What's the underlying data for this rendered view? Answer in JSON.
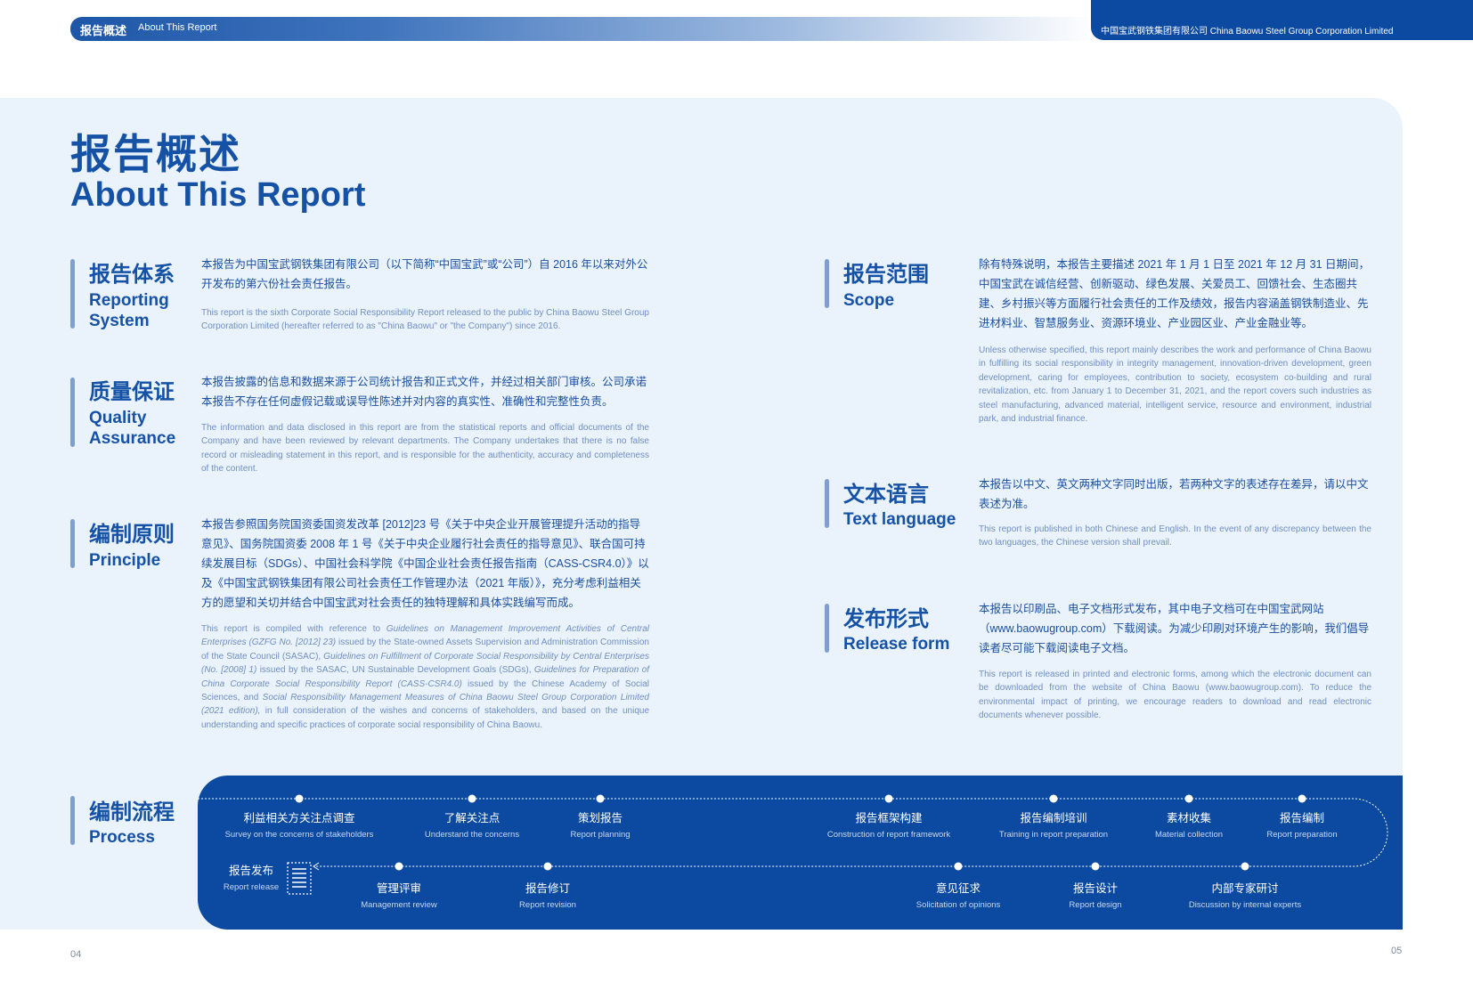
{
  "header": {
    "section_zh": "报告概述",
    "section_en": "About This Report",
    "company": "中国宝武钢铁集团有限公司 China Baowu Steel Group Corporation Limited"
  },
  "title": {
    "zh": "报告概述",
    "en": "About This Report"
  },
  "sections": {
    "reporting_system": {
      "title_zh": "报告体系",
      "title_en": "Reporting System",
      "body_zh": "本报告为中国宝武钢铁集团有限公司（以下简称“中国宝武”或“公司”）自 2016 年以来对外公开发布的第六份社会责任报告。",
      "body_en": "This report is the sixth Corporate Social Responsibility Report released to the public by China Baowu Steel Group Corporation Limited (hereafter referred to as \"China Baowu\" or \"the Company\") since 2016."
    },
    "quality": {
      "title_zh": "质量保证",
      "title_en": "Quality Assurance",
      "body_zh": "本报告披露的信息和数据来源于公司统计报告和正式文件，并经过相关部门审核。公司承诺本报告不存在任何虚假记载或误导性陈述并对内容的真实性、准确性和完整性负责。",
      "body_en": "The information and data disclosed in this report are from the statistical reports and official documents of the Company and have been reviewed by relevant departments. The Company undertakes that there is no false record or misleading statement in this report, and is responsible for the authenticity, accuracy and completeness of the content."
    },
    "principle": {
      "title_zh": "编制原则",
      "title_en": "Principle",
      "body_zh": "本报告参照国务院国资委国资发改革 [2012]23 号《关于中央企业开展管理提升活动的指导意见》、国务院国资委 2008 年 1 号《关于中央企业履行社会责任的指导意见》、联合国可持续发展目标（SDGs）、中国社会科学院《中国企业社会责任报告指南（CASS-CSR4.0）》以及《中国宝武钢铁集团有限公司社会责任工作管理办法（2021 年版）》，充分考虑利益相关方的愿望和关切并结合中国宝武对社会责任的独特理解和具体实践编写而成。",
      "body_en_1": "This report is compiled with reference to ",
      "body_en_2": "Guidelines on Management Improvement Activities of Central Enterprises (GZFG No. [2012] 23)",
      "body_en_3": " issued by the State-owned Assets Supervision and Administration Commission of the State Council (SASAC), ",
      "body_en_4": "Guidelines on Fulfillment of Corporate Social Responsibility by Central Enterprises (No. [2008] 1)",
      "body_en_5": " issued by the SASAC, UN Sustainable Development Goals (SDGs), ",
      "body_en_6": "Guidelines for Preparation of China Corporate Social Responsibility Report (CASS-CSR4.0)",
      "body_en_7": " issued by the Chinese Academy of Social Sciences, and ",
      "body_en_8": "Social Responsibility Management Measures of China Baowu Steel Group Corporation Limited (2021 edition),",
      "body_en_9": " in full consideration of the wishes and concerns of stakeholders, and based on the unique understanding and specific practices of corporate social responsibility of China Baowu."
    },
    "scope": {
      "title_zh": "报告范围",
      "title_en": "Scope",
      "body_zh": "除有特殊说明，本报告主要描述 2021 年 1 月 1 日至 2021 年 12 月 31 日期间，中国宝武在诚信经营、创新驱动、绿色发展、关爱员工、回馈社会、生态圈共建、乡村振兴等方面履行社会责任的工作及绩效，报告内容涵盖钢铁制造业、先进材料业、智慧服务业、资源环境业、产业园区业、产业金融业等。",
      "body_en": "Unless otherwise specified, this report mainly describes the work and performance of China Baowu in fulfilling its social responsibility in integrity management, innovation-driven development, green development, caring for employees, contribution to society, ecosystem co-building and rural revitalization, etc. from January 1 to December 31, 2021, and the report covers such industries as steel manufacturing, advanced material, intelligent service, resource and environment, industrial park, and industrial finance."
    },
    "language": {
      "title_zh": "文本语言",
      "title_en": "Text language",
      "body_zh": "本报告以中文、英文两种文字同时出版，若两种文字的表述存在差异，请以中文表述为准。",
      "body_en": "This report is published in both Chinese and English. In the event of any discrepancy between the two languages, the Chinese version shall prevail."
    },
    "release": {
      "title_zh": "发布形式",
      "title_en": "Release form",
      "body_zh": "本报告以印刷品、电子文档形式发布，其中电子文档可在中国宝武网站（www.baowugroup.com）下载阅读。为减少印刷对环境产生的影响，我们倡导读者尽可能下载阅读电子文档。",
      "body_en": "This report is released in printed and electronic forms, among which the electronic document can be downloaded from the website of China Baowu (www.baowugroup.com). To reduce the environmental impact of printing, we encourage readers to download and read electronic documents whenever possible."
    }
  },
  "process": {
    "title_zh": "编制流程",
    "title_en": "Process",
    "top_steps": [
      {
        "zh": "利益相关方关注点调查",
        "en": "Survey on the concerns of stakeholders"
      },
      {
        "zh": "了解关注点",
        "en": "Understand the concerns"
      },
      {
        "zh": "策划报告",
        "en": "Report planning"
      },
      {
        "zh": "报告框架构建",
        "en": "Construction of report framework"
      },
      {
        "zh": "报告编制培训",
        "en": "Training in report preparation"
      },
      {
        "zh": "素材收集",
        "en": "Material collection"
      },
      {
        "zh": "报告编制",
        "en": "Report preparation"
      }
    ],
    "bottom_steps": [
      {
        "zh": "管理评审",
        "en": "Management review"
      },
      {
        "zh": "报告修订",
        "en": "Report revision"
      },
      {
        "zh": "意见征求",
        "en": "Solicitation of opinions"
      },
      {
        "zh": "报告设计",
        "en": "Report design"
      },
      {
        "zh": "内部专家研讨",
        "en": "Discussion by internal experts"
      }
    ],
    "release": {
      "zh": "报告发布",
      "en": "Report release",
      "icon": "document-list-icon"
    }
  },
  "pages": {
    "left": "04",
    "right": "05"
  },
  "colors": {
    "brand": "#0b4aa0",
    "panel": "#eaf2fb",
    "accent_bar": "#7f9fd1"
  }
}
